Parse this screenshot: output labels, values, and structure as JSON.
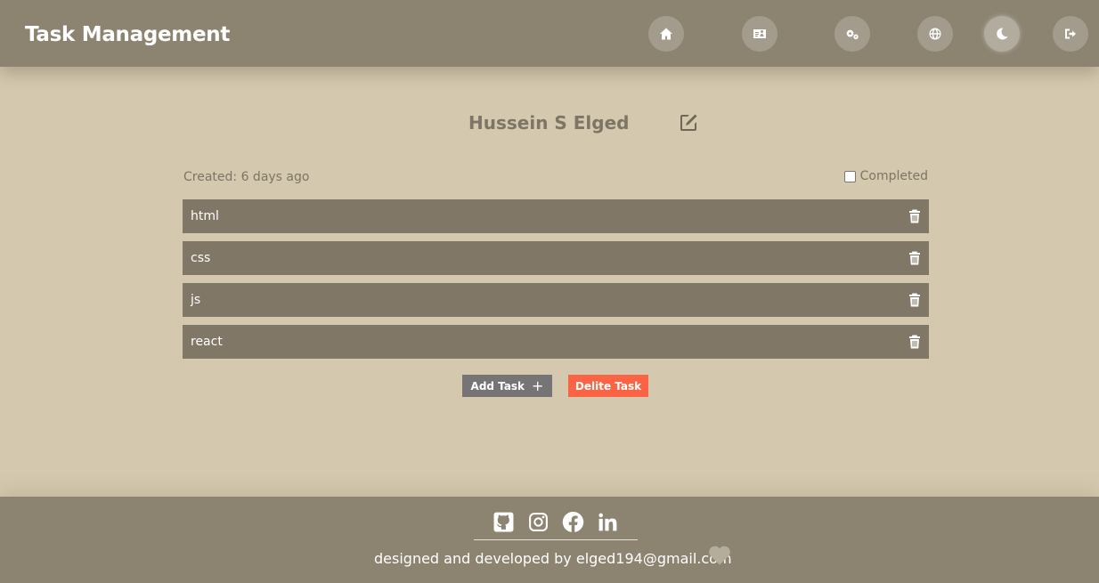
{
  "header": {
    "title": "Task Management",
    "nav": [
      {
        "icon": "home-icon"
      },
      {
        "icon": "id-card-icon"
      },
      {
        "icon": "gears-icon"
      },
      {
        "icon": "globe-icon"
      },
      {
        "icon": "moon-icon"
      },
      {
        "icon": "logout-icon"
      }
    ]
  },
  "main": {
    "user_name": "Hussein S Elged",
    "created": "Created: 6 days ago",
    "completed_label": "Completed",
    "completed_checked": false,
    "tasks": [
      {
        "text": "html"
      },
      {
        "text": "css"
      },
      {
        "text": "js"
      },
      {
        "text": "react"
      }
    ],
    "add_task_label": "Add Task",
    "add_task_symbol": "+",
    "delete_task_label": "Delite Task"
  },
  "footer": {
    "socials": [
      "github-icon",
      "instagram-icon",
      "facebook-icon",
      "linkedin-icon"
    ],
    "credit": "designed and developed by elged194@gmail.com"
  },
  "colors": {
    "background": "#d4c8ae",
    "header": "#8c8471",
    "task_row": "#807766",
    "add_button": "#767474",
    "delete_button": "#fa6445"
  }
}
